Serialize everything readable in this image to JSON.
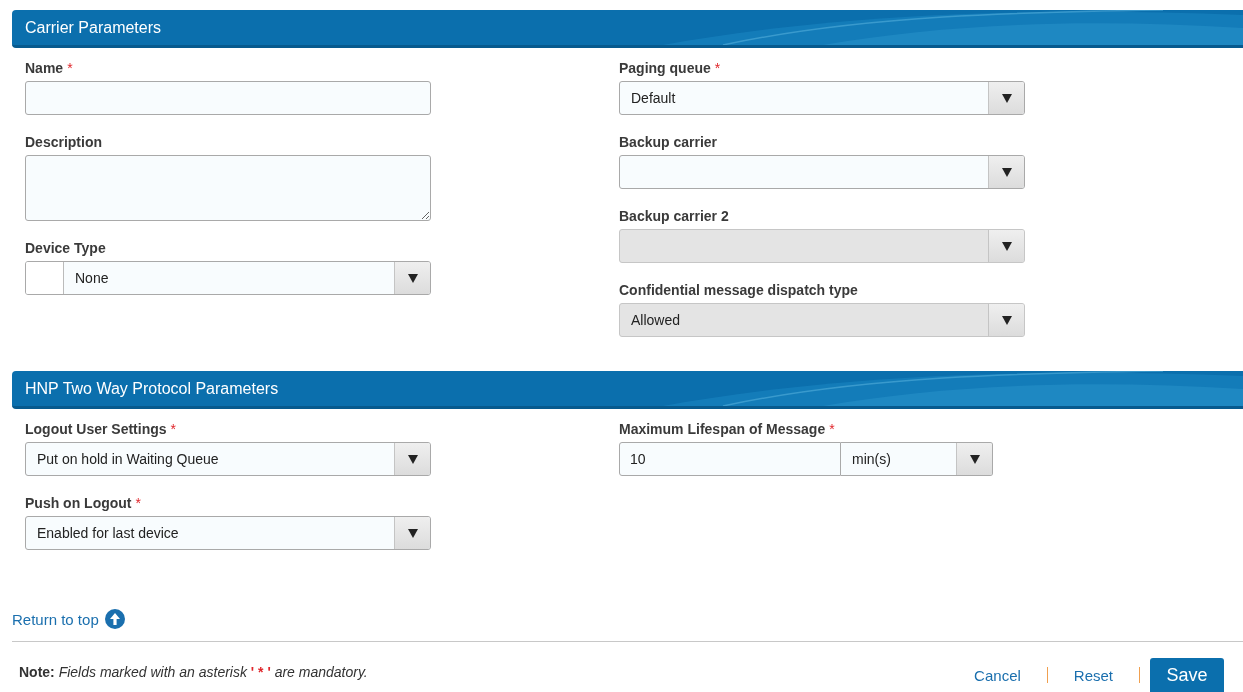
{
  "sections": [
    {
      "title": "Carrier Parameters",
      "columns": [
        [
          {
            "kind": "text",
            "label": "Name",
            "mark": "*",
            "disabled": false
          },
          {
            "kind": "textarea",
            "label": "Description",
            "disabled": false
          },
          {
            "kind": "select_icon",
            "label": "Device Type",
            "value": "None",
            "disabled": false
          }
        ],
        [
          {
            "kind": "select",
            "label": "Paging queue",
            "mark": "*",
            "value": "Default",
            "disabled": false
          },
          {
            "kind": "select",
            "label": "Backup carrier",
            "disabled": false
          },
          {
            "kind": "select",
            "label": "Backup carrier 2",
            "disabled": true
          },
          {
            "kind": "select",
            "label": "Confidential message dispatch type",
            "value": "Allowed",
            "disabled": true
          }
        ]
      ]
    },
    {
      "title": "HNP Two Way Protocol Parameters",
      "columns": [
        [
          {
            "kind": "select",
            "label": "Logout User Settings",
            "mark": "*",
            "value": "Put on hold in Waiting Queue",
            "disabled": false
          },
          {
            "kind": "select",
            "label": "Push on Logout",
            "mark": "*",
            "value": "Enabled for last device",
            "disabled": false
          }
        ],
        [
          {
            "kind": "number_unit",
            "label": "Maximum Lifespan of Message",
            "mark": "*",
            "value": "10",
            "unit": "min(s)",
            "disabled": false
          }
        ]
      ]
    }
  ],
  "return_link": "Return to top",
  "note": {
    "label": "Note:",
    "before": "Fields marked with an asterisk",
    "marker": "' * '",
    "after": "are mandatory."
  },
  "actions": [
    {
      "label": "Cancel",
      "kind": "link"
    },
    {
      "label": "Reset",
      "kind": "link"
    },
    {
      "label": "Save",
      "kind": "primary"
    }
  ]
}
